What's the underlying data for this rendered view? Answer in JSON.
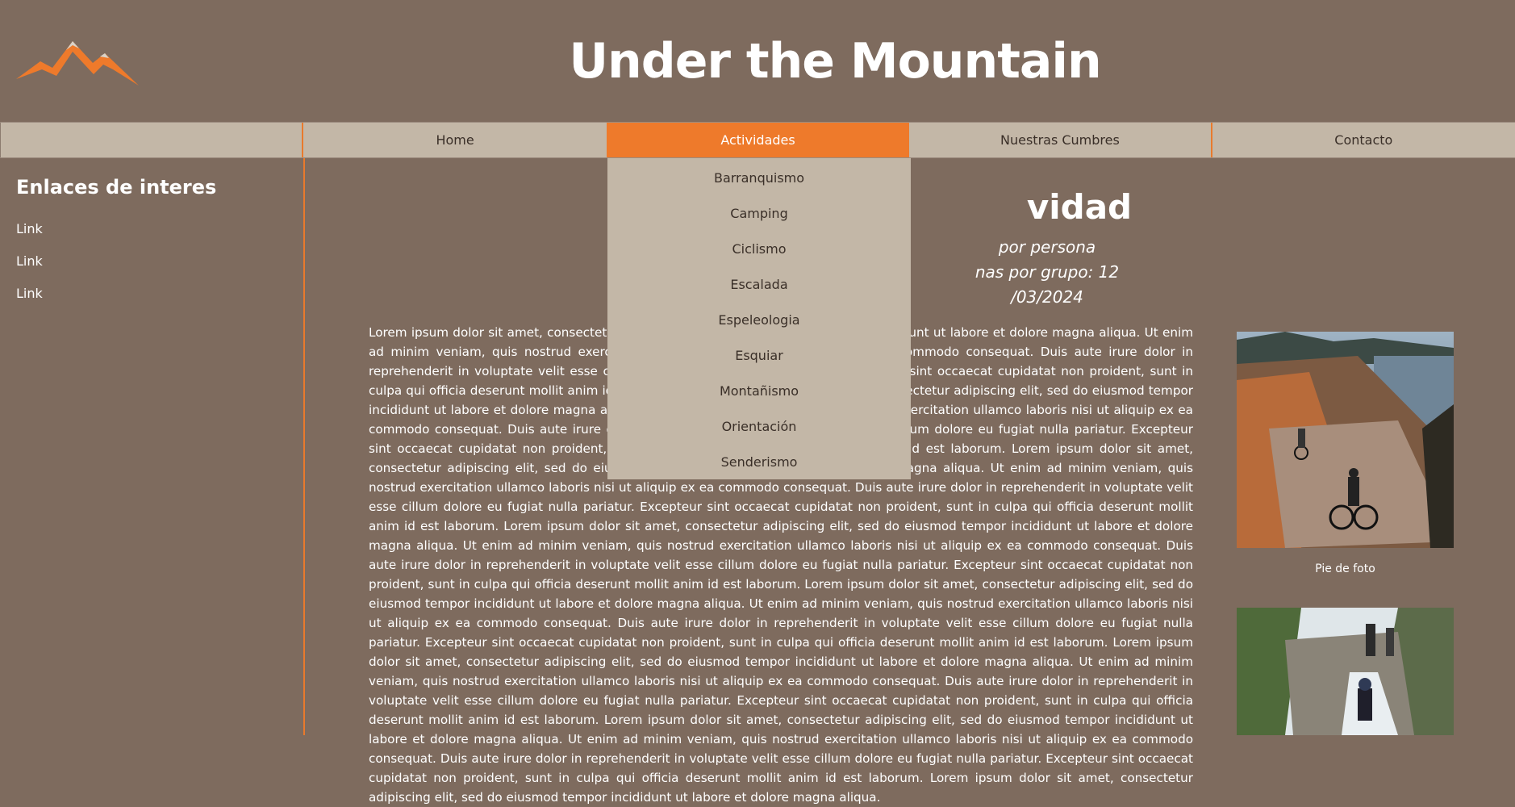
{
  "header": {
    "logo_icon": "mountain-logo-icon",
    "title": "Under the Mountain"
  },
  "colors": {
    "background": "#7e6b5e",
    "nav_bg": "#c3b7a7",
    "accent": "#ee7a2b"
  },
  "nav": {
    "items": [
      {
        "label": "Home"
      },
      {
        "label": "Actividades"
      },
      {
        "label": "Nuestras Cumbres"
      },
      {
        "label": "Contacto"
      }
    ],
    "active_item": "Actividades",
    "dropdown": [
      {
        "label": "Barranquismo"
      },
      {
        "label": "Camping"
      },
      {
        "label": "Ciclismo"
      },
      {
        "label": "Escalada"
      },
      {
        "label": "Espeleologia"
      },
      {
        "label": "Esquiar"
      },
      {
        "label": "Montañismo"
      },
      {
        "label": "Orientación"
      },
      {
        "label": "Senderismo"
      }
    ]
  },
  "sidebar": {
    "title": "Enlaces de interes",
    "links": [
      {
        "label": "Link"
      },
      {
        "label": "Link"
      },
      {
        "label": "Link"
      }
    ]
  },
  "main": {
    "title_visible": "vidad",
    "meta": [
      "por persona",
      "nas por grupo: 12",
      "/03/2024"
    ],
    "body_text": "Lorem ipsum dolor sit amet, consectetur adipiscing elit, sed do eiusmod tempor incididunt ut labore et dolore magna aliqua. Ut enim ad minim veniam, quis nostrud exercitation ullamco laboris nisi ut aliquip ex ea commodo consequat. Duis aute irure dolor in reprehenderit in voluptate velit esse cillum dolore eu fugiat nulla pariatur. Excepteur sint occaecat cupidatat non proident, sunt in culpa qui officia deserunt mollit anim id est laborum. Lorem ipsum dolor sit amet, consectetur adipiscing elit, sed do eiusmod tempor incididunt ut labore et dolore magna aliqua. Ut enim ad minim veniam, quis nostrud exercitation ullamco laboris nisi ut aliquip ex ea commodo consequat. Duis aute irure dolor in reprehenderit in voluptate velit esse cillum dolore eu fugiat nulla pariatur. Excepteur sint occaecat cupidatat non proident, sunt in culpa qui officia deserunt mollit anim id est laborum. Lorem ipsum dolor sit amet, consectetur adipiscing elit, sed do eiusmod tempor incididunt ut labore et dolore magna aliqua. Ut enim ad minim veniam, quis nostrud exercitation ullamco laboris nisi ut aliquip ex ea commodo consequat. Duis aute irure dolor in reprehenderit in voluptate velit esse cillum dolore eu fugiat nulla pariatur. Excepteur sint occaecat cupidatat non proident, sunt in culpa qui officia deserunt mollit anim id est laborum. Lorem ipsum dolor sit amet, consectetur adipiscing elit, sed do eiusmod tempor incididunt ut labore et dolore magna aliqua. Ut enim ad minim veniam, quis nostrud exercitation ullamco laboris nisi ut aliquip ex ea commodo consequat. Duis aute irure dolor in reprehenderit in voluptate velit esse cillum dolore eu fugiat nulla pariatur. Excepteur sint occaecat cupidatat non proident, sunt in culpa qui officia deserunt mollit anim id est laborum. Lorem ipsum dolor sit amet, consectetur adipiscing elit, sed do eiusmod tempor incididunt ut labore et dolore magna aliqua. Ut enim ad minim veniam, quis nostrud exercitation ullamco laboris nisi ut aliquip ex ea commodo consequat. Duis aute irure dolor in reprehenderit in voluptate velit esse cillum dolore eu fugiat nulla pariatur. Excepteur sint occaecat cupidatat non proident, sunt in culpa qui officia deserunt mollit anim id est laborum. Lorem ipsum dolor sit amet, consectetur adipiscing elit, sed do eiusmod tempor incididunt ut labore et dolore magna aliqua. Ut enim ad minim veniam, quis nostrud exercitation ullamco laboris nisi ut aliquip ex ea commodo consequat. Duis aute irure dolor in reprehenderit in voluptate velit esse cillum dolore eu fugiat nulla pariatur. Excepteur sint occaecat cupidatat non proident, sunt in culpa qui officia deserunt mollit anim id est laborum. Lorem ipsum dolor sit amet, consectetur adipiscing elit, sed do eiusmod tempor incididunt ut labore et dolore magna aliqua. Ut enim ad minim veniam, quis nostrud exercitation ullamco laboris nisi ut aliquip ex ea commodo consequat. Duis aute irure dolor in reprehenderit in voluptate velit esse cillum dolore eu fugiat nulla pariatur. Excepteur sint occaecat cupidatat non proident, sunt in culpa qui officia deserunt mollit anim id est laborum. Lorem ipsum dolor sit amet, consectetur adipiscing elit, sed do eiusmod tempor incididunt ut labore et dolore magna aliqua."
  },
  "photos": [
    {
      "caption": "Pie de foto",
      "alt_icon": "mountain-bike-photo"
    },
    {
      "alt_icon": "canyoning-photo"
    }
  ]
}
